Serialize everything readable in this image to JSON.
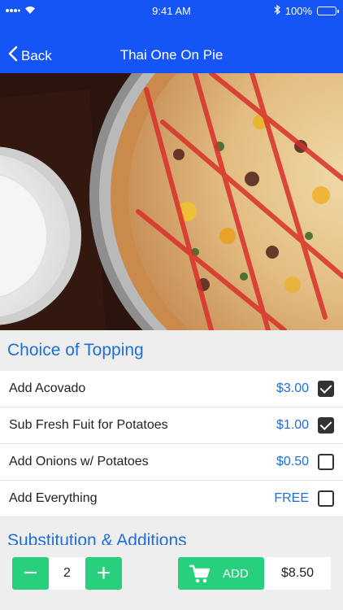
{
  "status_bar": {
    "time": "9:41 AM",
    "battery": "100%"
  },
  "nav": {
    "back_label": "Back",
    "title": "Thai One On Pie"
  },
  "toppings": {
    "header": "Choice of Topping",
    "items": [
      {
        "label": "Add Acovado",
        "price": "$3.00",
        "checked": true
      },
      {
        "label": "Sub Fresh Fuit for Potatoes",
        "price": "$1.00",
        "checked": true
      },
      {
        "label": "Add Onions w/ Potatoes",
        "price": "$0.50",
        "checked": false
      },
      {
        "label": "Add Everything",
        "price": "FREE",
        "checked": false
      }
    ]
  },
  "substitutions": {
    "header": "Substitution & Additions"
  },
  "order_bar": {
    "decrement": "−",
    "quantity": "2",
    "increment": "+",
    "add_label": "ADD",
    "total": "$8.50"
  },
  "colors": {
    "nav": "#1554f5",
    "accent_text": "#1d6fd8",
    "green": "#27d07c"
  },
  "icons": [
    "wifi-icon",
    "signal-icon",
    "bluetooth-icon",
    "battery-icon",
    "chevron-left-icon",
    "cart-icon",
    "checkmark-icon"
  ]
}
